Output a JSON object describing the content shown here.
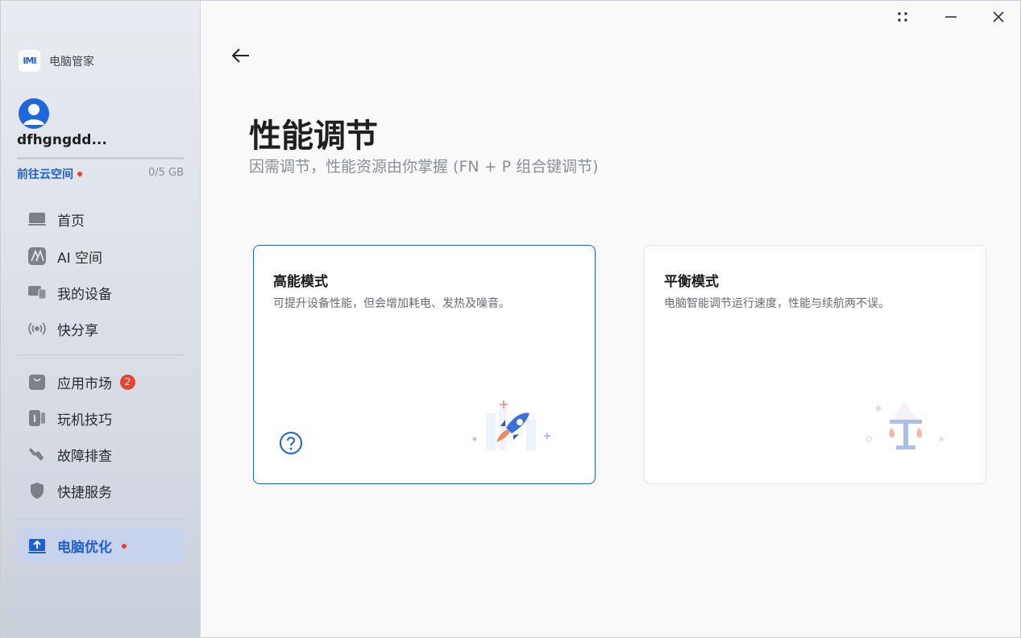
{
  "app": {
    "name": "电脑管家",
    "logo_text": "IMI"
  },
  "account": {
    "username": "dfhgngdd...",
    "cloud_link": "前往云空间",
    "storage": "0/5 GB"
  },
  "sidebar": {
    "items": [
      {
        "label": "首页",
        "icon": "laptop-icon"
      },
      {
        "label": "AI 空间",
        "icon": "ai-icon"
      },
      {
        "label": "我的设备",
        "icon": "devices-icon"
      },
      {
        "label": "快分享",
        "icon": "share-icon"
      },
      {
        "label": "应用市场",
        "icon": "store-icon",
        "badge": "2"
      },
      {
        "label": "玩机技巧",
        "icon": "tips-icon"
      },
      {
        "label": "故障排查",
        "icon": "wrench-icon"
      },
      {
        "label": "快捷服务",
        "icon": "shield-icon"
      },
      {
        "label": "电脑优化",
        "icon": "optimize-icon",
        "active": true
      }
    ]
  },
  "window_controls": {
    "more": "more-icon",
    "minimize": "minimize-icon",
    "close": "close-icon"
  },
  "main": {
    "title": "性能调节",
    "subtitle": "因需调节，性能资源由你掌握 (FN + P 组合键调节)",
    "cards": [
      {
        "title": "高能模式",
        "desc": "可提升设备性能，但会增加耗电、发热及噪音。",
        "selected": true
      },
      {
        "title": "平衡模式",
        "desc": "电脑智能调节运行速度，性能与续航两不误。",
        "selected": false
      }
    ]
  },
  "colors": {
    "accent": "#1d5fd6",
    "badge_red": "#e84233"
  }
}
